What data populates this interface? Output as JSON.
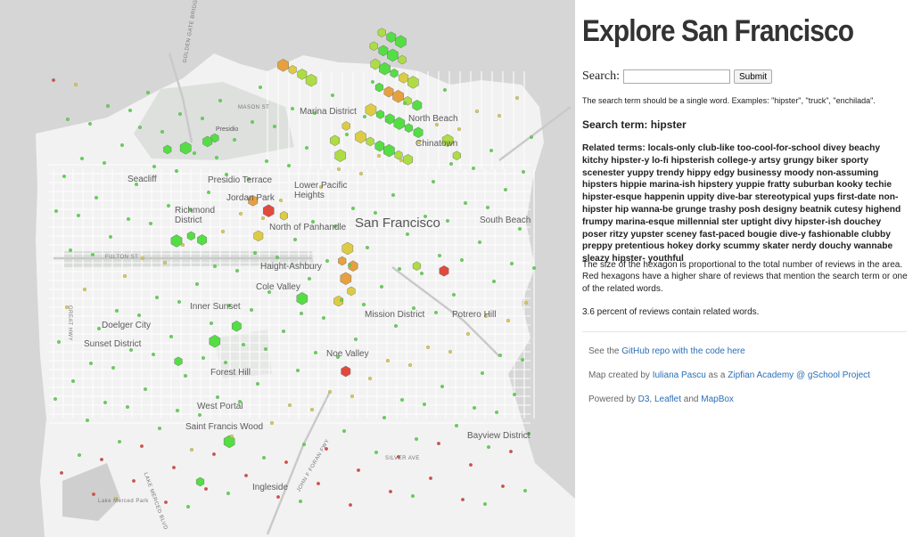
{
  "panel": {
    "title": "Explore San Francisco",
    "search_label": "Search:",
    "search_value": "",
    "submit_label": "Submit",
    "hint": "The search term should be a single word. Examples: \"hipster\", \"truck\", \"enchilada\".",
    "search_term_text": "Search term: hipster",
    "related_terms_text": "Related terms: locals-only club-like too-cool-for-school divey beachy kitchy hipster-y lo-fi hipsterish college-y artsy grungy biker sporty scenester yuppy trendy hippy edgy businessy moody non-assuming hipsters hippie marina-ish hipstery yuppie fratty suburban kooky techie hipster-esque happenin uppity dive-bar stereotypical yups first-date non-hipster hip wanna-be grunge trashy posh designy beatnik cutesy highend frumpy marina-esque millennial ster uptight divy hipster-ish douchey poser ritzy yupster sceney fast-paced bougie dive-y fashionable clubby preppy pretentious hokey dorky scummy skater nerdy douchy wannabe sleazy hipster- youthful",
    "description_line1": "The size of the hexagon is proportional to the total number of reviews in the area.",
    "description_line2": "Red hexagons have a higher share of reviews that mention the search term or one of the related words.",
    "percent_text": "3.6 percent of reviews contain related words.",
    "repo_prefix": "See the ",
    "repo_link": "GitHub repo with the code here",
    "created_prefix": "Map created by ",
    "author_link": "Iuliana Pascu",
    "created_mid": " as a ",
    "academy_link": "Zipfian Academy @ gSchool Project",
    "powered_prefix": "Powered by ",
    "d3_link": "D3",
    "comma": ", ",
    "leaflet_link": "Leaflet",
    "and_text": " and ",
    "mapbox_link": "MapBox"
  },
  "map": {
    "city_label": "San Francisco",
    "neighborhoods": [
      "Marina District",
      "North Beach",
      "Chinatown",
      "Presidio Terrace",
      "Lower Pacific Heights",
      "Jordan Park",
      "Richmond District",
      "North of Panhandle",
      "Haight-Ashbury",
      "Cole Valley",
      "Inner Sunset",
      "Doelger City",
      "Sunset District",
      "Mission District",
      "Potrero Hill",
      "South Beach",
      "Noe Valley",
      "Forest Hill",
      "West Portal",
      "Saint Francis Wood",
      "Bayview District",
      "Ingleside",
      "Presidio",
      "Seacliff"
    ],
    "streets": [
      "FULTON ST",
      "GREAT HWY",
      "MASON ST",
      "SILVER AVE",
      "GOLDEN GATE BRIDGE",
      "JOHN F FORAN FWY",
      "LAKE MERCED BLVD",
      "Lake Merced Park"
    ],
    "colors": {
      "low": "#55dd44",
      "mid_low": "#aedc44",
      "mid": "#dccc44",
      "mid_high": "#e6a040",
      "high": "#e04a3c"
    },
    "hexagons": [
      {
        "lon": -122.4101,
        "lat": 37.8055,
        "share": 0.2
      },
      {
        "lon": -122.4075,
        "lat": 37.8046,
        "share": 0.1
      },
      {
        "lon": -122.4049,
        "lat": 37.8037,
        "share": 0.15
      },
      {
        "lon": -122.4123,
        "lat": 37.8028,
        "share": 0.25
      },
      {
        "lon": -122.4097,
        "lat": 37.8019,
        "share": 0.1
      },
      {
        "lon": -122.4071,
        "lat": 37.801,
        "share": 0.05
      },
      {
        "lon": -122.4045,
        "lat": 37.8001,
        "share": 0.2
      },
      {
        "lon": -122.4119,
        "lat": 37.7992,
        "share": 0.3
      },
      {
        "lon": -122.4093,
        "lat": 37.7983,
        "share": 0.15
      },
      {
        "lon": -122.4067,
        "lat": 37.7974,
        "share": 0.1
      },
      {
        "lon": -122.4041,
        "lat": 37.7965,
        "share": 0.45
      },
      {
        "lon": -122.4015,
        "lat": 37.7956,
        "share": 0.2
      },
      {
        "lon": -122.4108,
        "lat": 37.7946,
        "share": 0.1
      },
      {
        "lon": -122.4082,
        "lat": 37.7937,
        "share": 0.6
      },
      {
        "lon": -122.4056,
        "lat": 37.7928,
        "share": 0.7
      },
      {
        "lon": -122.403,
        "lat": 37.7919,
        "share": 0.35
      },
      {
        "lon": -122.4004,
        "lat": 37.791,
        "share": 0.1
      },
      {
        "lon": -122.4131,
        "lat": 37.7901,
        "share": 0.55
      },
      {
        "lon": -122.4105,
        "lat": 37.7892,
        "share": 0.05
      },
      {
        "lon": -122.4079,
        "lat": 37.7883,
        "share": 0.1
      },
      {
        "lon": -122.4053,
        "lat": 37.7874,
        "share": 0.15
      },
      {
        "lon": -122.4027,
        "lat": 37.7865,
        "share": 0.05
      },
      {
        "lon": -122.4001,
        "lat": 37.7856,
        "share": 0.1
      },
      {
        "lon": -122.4159,
        "lat": 37.7847,
        "share": 0.4
      },
      {
        "lon": -122.4133,
        "lat": 37.7838,
        "share": 0.3
      },
      {
        "lon": -122.4107,
        "lat": 37.7829,
        "share": 0.1
      },
      {
        "lon": -122.4081,
        "lat": 37.782,
        "share": 0.05
      },
      {
        "lon": -122.4055,
        "lat": 37.7811,
        "share": 0.2
      },
      {
        "lon": -122.4029,
        "lat": 37.7802,
        "share": 0.25
      },
      {
        "lon": -122.4372,
        "lat": 37.799,
        "share": 0.6
      },
      {
        "lon": -122.4346,
        "lat": 37.7981,
        "share": 0.55
      },
      {
        "lon": -122.432,
        "lat": 37.7972,
        "share": 0.3
      },
      {
        "lon": -122.4295,
        "lat": 37.796,
        "share": 0.2
      },
      {
        "lon": -122.4199,
        "lat": 37.7869,
        "share": 0.5
      },
      {
        "lon": -122.423,
        "lat": 37.784,
        "share": 0.3
      },
      {
        "lon": -122.4215,
        "lat": 37.781,
        "share": 0.2
      },
      {
        "lon": -122.456,
        "lat": 37.7845,
        "share": 0.05
      },
      {
        "lon": -122.458,
        "lat": 37.7838,
        "share": 0.1
      },
      {
        "lon": -122.464,
        "lat": 37.7825,
        "share": 0.05
      },
      {
        "lon": -122.469,
        "lat": 37.7822,
        "share": 0.1
      },
      {
        "lon": -122.4455,
        "lat": 37.772,
        "share": 0.7
      },
      {
        "lon": -122.4412,
        "lat": 37.77,
        "share": 0.9
      },
      {
        "lon": -122.437,
        "lat": 37.769,
        "share": 0.5
      },
      {
        "lon": -122.444,
        "lat": 37.765,
        "share": 0.4
      },
      {
        "lon": -122.4665,
        "lat": 37.764,
        "share": 0.05
      },
      {
        "lon": -122.4625,
        "lat": 37.765,
        "share": 0.05
      },
      {
        "lon": -122.4595,
        "lat": 37.7642,
        "share": 0.05
      },
      {
        "lon": -122.4195,
        "lat": 37.7625,
        "share": 0.55
      },
      {
        "lon": -122.421,
        "lat": 37.76,
        "share": 0.6
      },
      {
        "lon": -122.418,
        "lat": 37.759,
        "share": 0.7
      },
      {
        "lon": -122.42,
        "lat": 37.7565,
        "share": 0.65
      },
      {
        "lon": -122.4185,
        "lat": 37.754,
        "share": 0.5
      },
      {
        "lon": -122.422,
        "lat": 37.752,
        "share": 0.4
      },
      {
        "lon": -122.432,
        "lat": 37.7525,
        "share": 0.1
      },
      {
        "lon": -122.4005,
        "lat": 37.759,
        "share": 0.2
      },
      {
        "lon": -122.393,
        "lat": 37.758,
        "share": 0.85
      },
      {
        "lon": -122.392,
        "lat": 37.784,
        "share": 0.3
      },
      {
        "lon": -122.3895,
        "lat": 37.781,
        "share": 0.2
      },
      {
        "lon": -122.45,
        "lat": 37.747,
        "share": 0.05
      },
      {
        "lon": -122.456,
        "lat": 37.744,
        "share": 0.05
      },
      {
        "lon": -122.466,
        "lat": 37.74,
        "share": 0.05
      },
      {
        "lon": -122.42,
        "lat": 37.738,
        "share": 0.8
      },
      {
        "lon": -122.452,
        "lat": 37.724,
        "share": 0.05
      },
      {
        "lon": -122.46,
        "lat": 37.716,
        "share": 0.05
      }
    ]
  }
}
